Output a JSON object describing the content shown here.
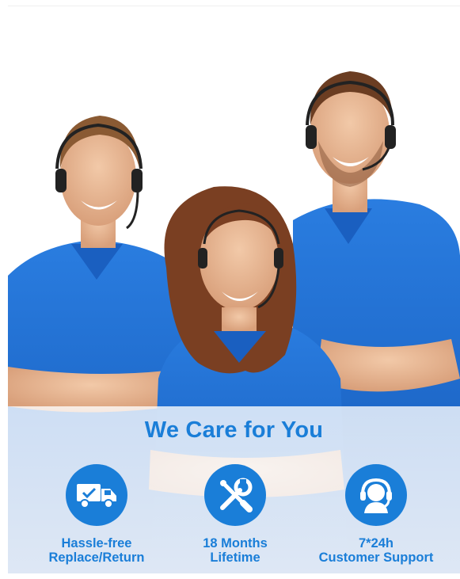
{
  "headline": "We Care for You",
  "features": [
    {
      "line1": "Hassle-free",
      "line2": "Replace/Return",
      "icon": "delivery-truck-icon"
    },
    {
      "line1": "18 Months",
      "line2": "Lifetime",
      "icon": "wrench-screwdriver-icon"
    },
    {
      "line1": "7*24h",
      "line2": "Customer Support",
      "icon": "headset-agent-icon"
    }
  ],
  "colors": {
    "accent": "#1a7ed8",
    "shirt": "#1f6fd6"
  }
}
